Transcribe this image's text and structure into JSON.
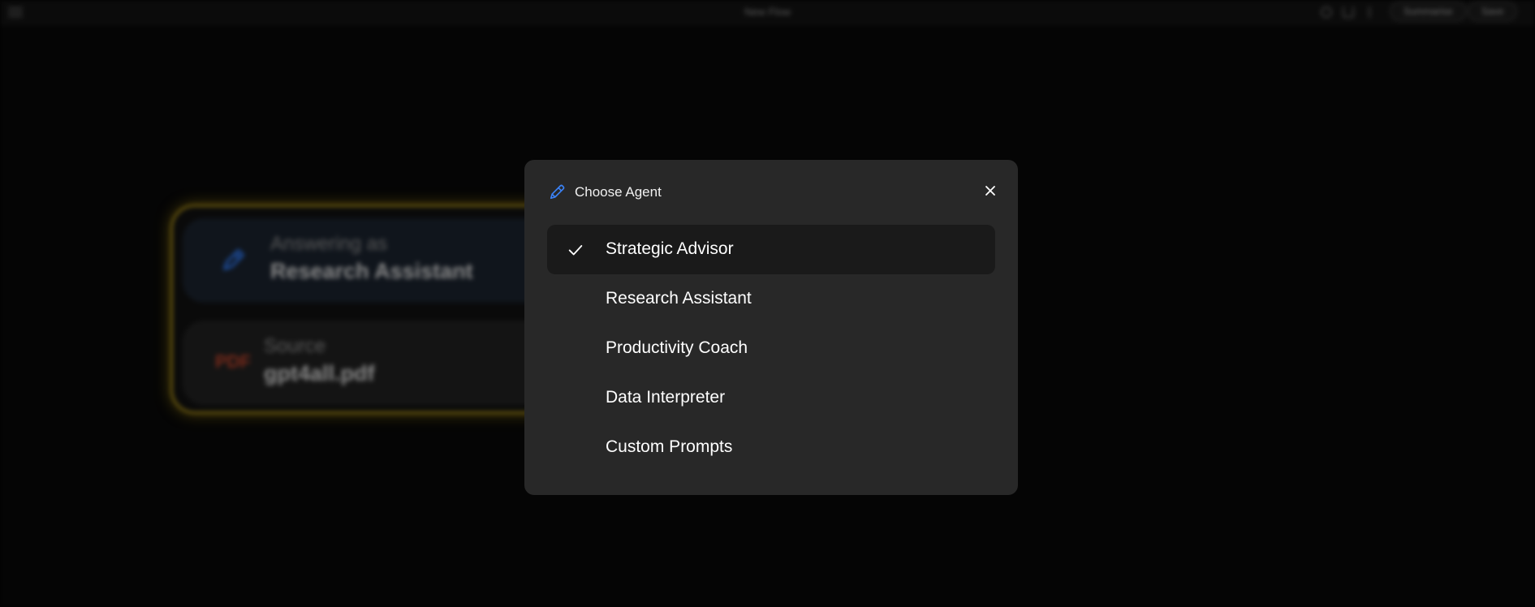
{
  "topbar": {
    "title": "New Flow",
    "summarise_label": "Summarise",
    "save_label": "Save"
  },
  "flow": {
    "agent_row": {
      "label": "Answering as",
      "value": "Research Assistant"
    },
    "source_row": {
      "icon_text": "PDF",
      "label": "Source",
      "value": "gpt4all.pdf"
    }
  },
  "modal": {
    "title": "Choose Agent",
    "items": [
      {
        "label": "Strategic Advisor",
        "selected": true
      },
      {
        "label": "Research Assistant",
        "selected": false
      },
      {
        "label": "Productivity Coach",
        "selected": false
      },
      {
        "label": "Data Interpreter",
        "selected": false
      },
      {
        "label": "Custom Prompts",
        "selected": false
      }
    ]
  },
  "colors": {
    "accent_blue": "#3b82f6",
    "card_glow": "#6b5a10",
    "modal_bg": "#282828",
    "selected_bg": "#1a1a1a"
  },
  "icons": {
    "header_icon": "pen-icon",
    "close_icon": "close-icon",
    "selected_icon": "check-icon"
  }
}
